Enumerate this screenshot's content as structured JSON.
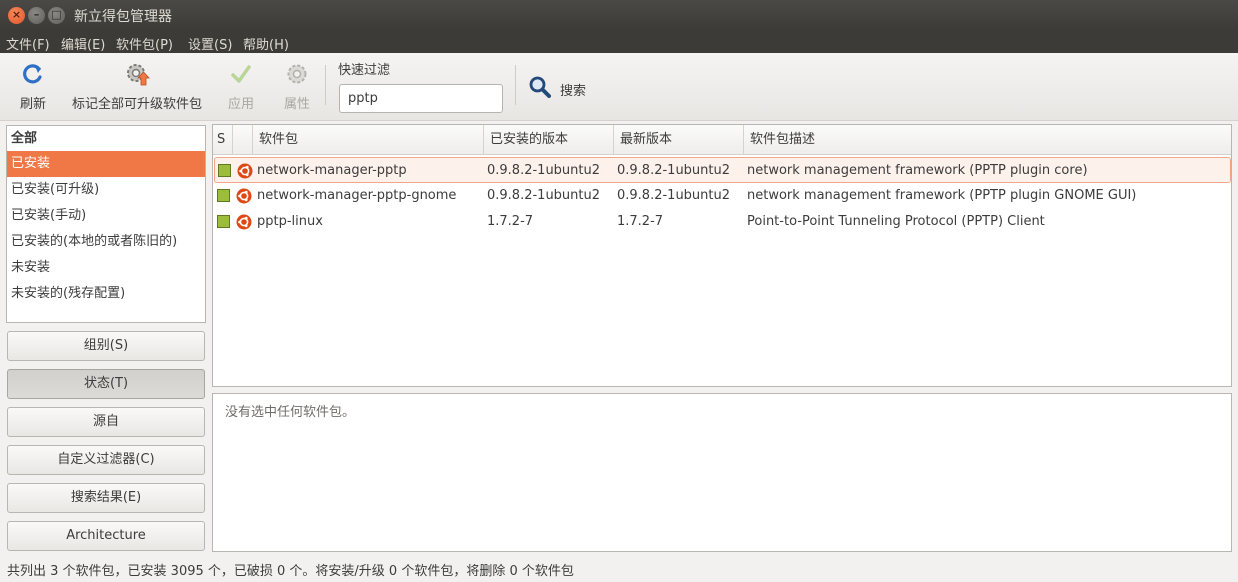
{
  "window": {
    "title": "新立得包管理器"
  },
  "menubar": [
    "文件(F)",
    "编辑(E)",
    "软件包(P)",
    "设置(S)",
    "帮助(H)"
  ],
  "toolbar": {
    "refresh": "刷新",
    "mark_all_upgrades": "标记全部可升级软件包",
    "apply": "应用",
    "properties": "属性",
    "quick_filter_label": "快速过滤",
    "quick_filter_value": "pptp",
    "search": "搜索"
  },
  "filters": {
    "header": "全部",
    "items": [
      "已安装",
      "已安装(可升级)",
      "已安装(手动)",
      "已安装的(本地的或者陈旧的)",
      "未安装",
      "未安装的(残存配置)"
    ],
    "selected": "已安装"
  },
  "side_buttons": {
    "sections": "组别(S)",
    "status": "状态(T)",
    "origin": "源自",
    "custom_filters": "自定义过滤器(C)",
    "search_results": "搜索结果(E)",
    "architecture": "Architecture"
  },
  "table": {
    "columns": {
      "status": "S",
      "package": "软件包",
      "installed_version": "已安装的版本",
      "latest_version": "最新版本",
      "description": "软件包描述"
    },
    "rows": [
      {
        "name": "network-manager-pptp",
        "installed": "0.9.8.2-1ubuntu2",
        "latest": "0.9.8.2-1ubuntu2",
        "description": "network management framework (PPTP plugin core)"
      },
      {
        "name": "network-manager-pptp-gnome",
        "installed": "0.9.8.2-1ubuntu2",
        "latest": "0.9.8.2-1ubuntu2",
        "description": "network management framework (PPTP plugin GNOME GUI)"
      },
      {
        "name": "pptp-linux",
        "installed": "1.7.2-7",
        "latest": "1.7.2-7",
        "description": "Point-to-Point Tunneling Protocol (PPTP) Client"
      }
    ]
  },
  "details": {
    "empty_text": "没有选中任何软件包。"
  },
  "statusbar": {
    "text": "共列出 3 个软件包，已安装 3095 个，已破损 0 个。将安装/升级 0 个软件包，将删除 0 个软件包"
  },
  "colors": {
    "accent": "#f07746",
    "titlebar": "#3c3b37",
    "installed_check": "#9cbc3b"
  }
}
